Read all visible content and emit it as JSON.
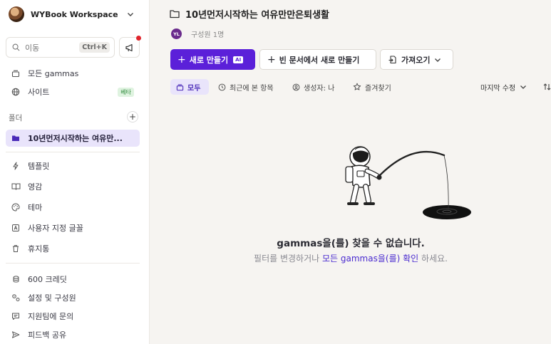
{
  "workspace": {
    "name": "WYBook Workspace"
  },
  "search": {
    "placeholder": "이동",
    "shortcut": "Ctrl+K"
  },
  "sidebar": {
    "top_items": [
      {
        "label": "모든 gammas",
        "icon": "stack-icon"
      },
      {
        "label": "사이트",
        "icon": "globe-icon",
        "badge": "베타"
      }
    ],
    "folders_label": "폴더",
    "folders": [
      {
        "label": "10년먼저시작하는 여유만..."
      }
    ],
    "tools": [
      {
        "label": "템플릿",
        "icon": "bolt-icon"
      },
      {
        "label": "영감",
        "icon": "book-icon"
      },
      {
        "label": "테마",
        "icon": "palette-icon"
      },
      {
        "label": "사용자 지정 글꼴",
        "icon": "font-icon"
      },
      {
        "label": "휴지통",
        "icon": "trash-icon"
      }
    ],
    "bottom": [
      {
        "label": "600 크레딧",
        "icon": "coins-icon"
      },
      {
        "label": "설정 및 구성원",
        "icon": "settings-icon"
      },
      {
        "label": "지원팀에 문의",
        "icon": "chat-icon"
      },
      {
        "label": "피드백 공유",
        "icon": "send-icon"
      }
    ]
  },
  "main": {
    "title": "10년먼저시작하는 여유만만은퇴생활",
    "member_initials": "YL",
    "members_text": "구성원 1명",
    "buttons": {
      "create": "새로 만들기",
      "ai_badge": "AI",
      "blank": "빈 문서에서 새로 만들기",
      "import": "가져오기"
    },
    "filters": [
      "모두",
      "최근에 본 항목",
      "생성자: 나",
      "즐겨찾기"
    ],
    "sort_label": "마지막 수정",
    "empty": {
      "title": "gammas을(를) 찾을 수 없습니다.",
      "sub_prefix": "필터를 변경하거나",
      "sub_link": "모든 gammas을(를) 확인",
      "sub_suffix": "하세요."
    }
  },
  "colors": {
    "accent": "#5b20d9",
    "active_bg": "#e9e4fb",
    "notification": "#e0242c"
  }
}
